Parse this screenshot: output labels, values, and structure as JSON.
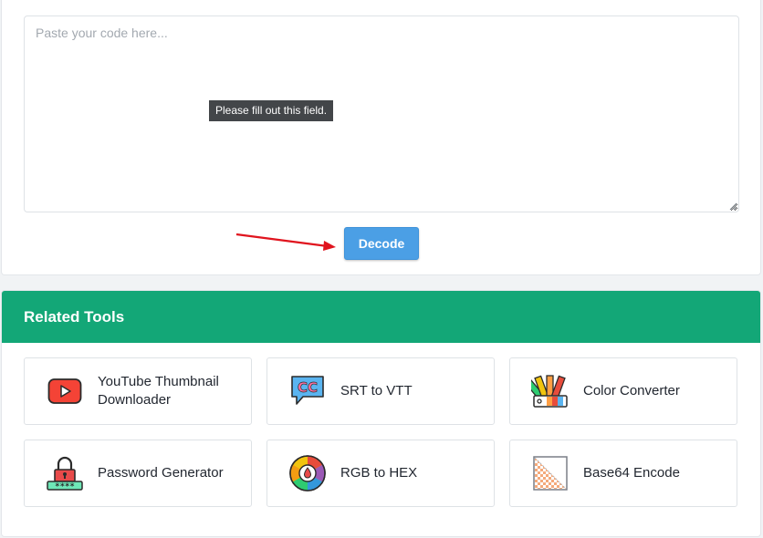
{
  "decoder": {
    "input_placeholder": "Paste your code here...",
    "input_value": "",
    "tooltip_text": "Please fill out this field.",
    "decode_label": "Decode"
  },
  "related": {
    "title": "Related Tools",
    "tools": [
      {
        "label": "YouTube Thumbnail Downloader",
        "icon": "youtube-icon"
      },
      {
        "label": "SRT to VTT",
        "icon": "cc-subtitle-icon"
      },
      {
        "label": "Color Converter",
        "icon": "color-palette-icon"
      },
      {
        "label": "Password Generator",
        "icon": "padlock-icon"
      },
      {
        "label": "RGB to HEX",
        "icon": "color-wheel-icon"
      },
      {
        "label": "Base64 Encode",
        "icon": "image-encode-icon"
      }
    ]
  },
  "colors": {
    "header_green": "#13a777",
    "decode_blue": "#4b9fe5",
    "arrow_red": "#e0141e"
  }
}
